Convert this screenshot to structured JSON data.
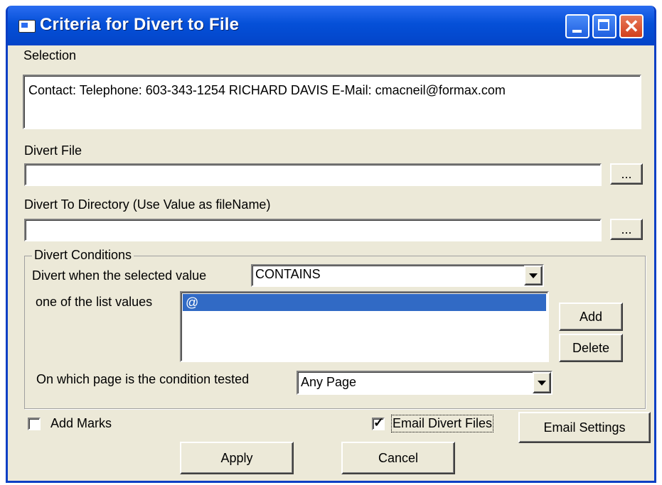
{
  "window": {
    "title": "Criteria for Divert to File",
    "accent_color": "#0550d8"
  },
  "selection": {
    "label": "Selection",
    "value": "Contact: Telephone: 603-343-1254 RICHARD DAVIS  E-Mail: cmacneil@formax.com"
  },
  "divert_file": {
    "label": "Divert File",
    "value": "",
    "browse_label": "..."
  },
  "divert_dir": {
    "label": "Divert To Directory (Use Value as fileName)",
    "value": "",
    "browse_label": "..."
  },
  "conditions": {
    "group_label": "Divert Conditions",
    "when_label": "Divert when the selected value",
    "operator": "CONTAINS",
    "list_label": "one of the list values",
    "list_values": [
      "@"
    ],
    "add_label": "Add",
    "delete_label": "Delete",
    "page_label": "On which page is the condition tested",
    "page_value": "Any Page"
  },
  "options": {
    "add_marks_label": "Add Marks",
    "add_marks_checked": false,
    "email_divert_label": "Email Divert Files",
    "email_divert_checked": true,
    "email_settings_label": "Email Settings"
  },
  "footer": {
    "apply_label": "Apply",
    "cancel_label": "Cancel"
  }
}
